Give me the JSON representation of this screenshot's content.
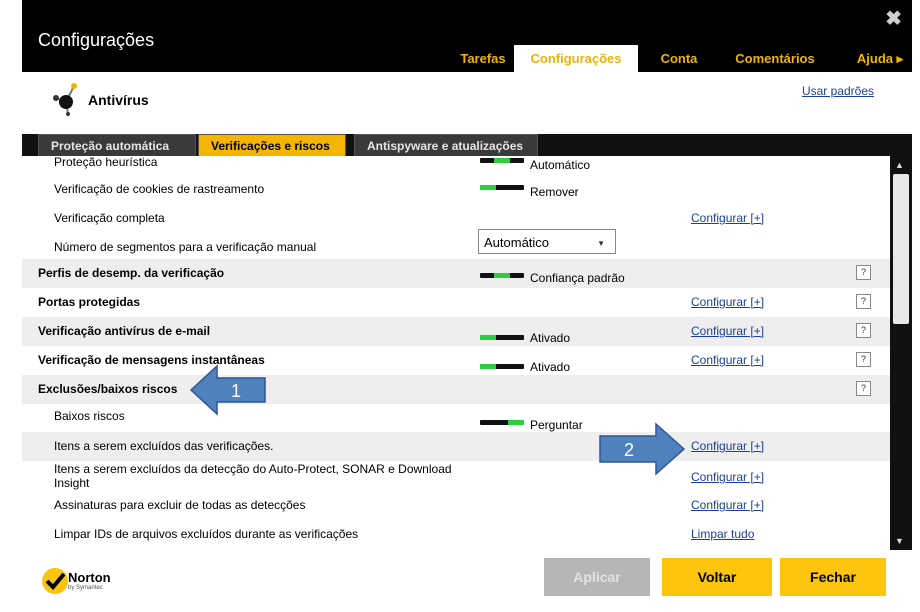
{
  "window": {
    "title": "Configurações",
    "close_glyph": "✖"
  },
  "top_tabs": [
    {
      "label": "Tarefas"
    },
    {
      "label": "Configurações"
    },
    {
      "label": "Conta"
    },
    {
      "label": "Comentários"
    },
    {
      "label": "Ajuda ▸"
    }
  ],
  "header": {
    "section_title": "Antivírus",
    "icon": "antivirus-molecule-icon",
    "use_defaults": "Usar padrões"
  },
  "sub_tabs": [
    {
      "label": "Proteção automática"
    },
    {
      "label": "Verificações e riscos"
    },
    {
      "label": "Antispyware e atualizações"
    }
  ],
  "rows": {
    "r0": {
      "label": "Proteção heurística",
      "toggle_text": "Automático"
    },
    "r1": {
      "label": "Verificação de cookies de rastreamento",
      "toggle_text": "Remover"
    },
    "r2": {
      "label": "Verificação completa",
      "link": "Configurar [+]"
    },
    "r3": {
      "label": "Número de segmentos para a verificação manual",
      "select_value": "Automático"
    },
    "r4": {
      "label": "Perfis de desemp. da verificação",
      "toggle_text": "Confiança padrão",
      "help": "?"
    },
    "r5": {
      "label": "Portas protegidas",
      "link": "Configurar [+]",
      "help": "?"
    },
    "r6": {
      "label": "Verificação antivírus de e-mail",
      "toggle_text": "Ativado",
      "link": "Configurar [+]",
      "help": "?"
    },
    "r7": {
      "label": "Verificação de mensagens instantâneas",
      "toggle_text": "Ativado",
      "link": "Configurar [+]",
      "help": "?"
    },
    "r8": {
      "label": "Exclusões/baixos riscos",
      "help": "?"
    },
    "r9": {
      "label": "Baixos riscos",
      "toggle_text": "Perguntar"
    },
    "r10": {
      "label": "Itens a serem excluídos das verificações.",
      "link": "Configurar [+]"
    },
    "r11": {
      "label": "Itens a serem excluídos da detecção do Auto-Protect, SONAR e Download Insight",
      "link": "Configurar [+]"
    },
    "r12": {
      "label": "Assinaturas para excluir de todas as detecções",
      "link": "Configurar [+]"
    },
    "r13": {
      "label": "Limpar IDs de arquivos excluídos durante as verificações",
      "link": "Limpar tudo"
    }
  },
  "footer": {
    "brand": "Norton",
    "brand_sub": "by Symantec",
    "apply": "Aplicar",
    "back": "Voltar",
    "close": "Fechar"
  },
  "callouts": {
    "c1": "1",
    "c2": "2"
  },
  "colors": {
    "accent": "#F4B400",
    "link": "#1B3F9C",
    "toggle_on": "#2ECC40",
    "callout_fill": "#4F81BD"
  }
}
